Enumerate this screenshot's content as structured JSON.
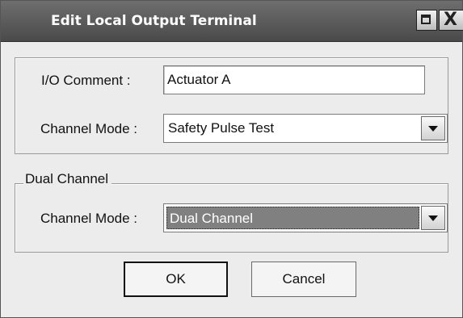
{
  "window": {
    "title": "Edit Local Output Terminal",
    "maximize_icon": "maximize-icon",
    "close_icon": "close-icon",
    "close_glyph": "X"
  },
  "io_group": {
    "io_comment_label": "I/O Comment :",
    "io_comment_value": "Actuator A",
    "channel_mode_label": "Channel Mode :",
    "channel_mode_value": "Safety Pulse Test"
  },
  "dual_group": {
    "legend": "Dual Channel",
    "channel_mode_label": "Channel Mode :",
    "channel_mode_value": "Dual Channel"
  },
  "buttons": {
    "ok": "OK",
    "cancel": "Cancel"
  },
  "colors": {
    "titlebar": "#5a5a5a",
    "dialog_bg": "#ececec",
    "selection": "#808080"
  }
}
